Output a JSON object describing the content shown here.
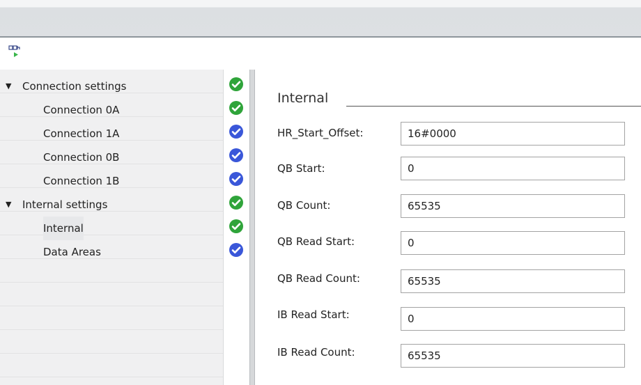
{
  "tree": [
    {
      "label": "Connection settings",
      "expanded": true,
      "level": 0,
      "status": "ok"
    },
    {
      "label": "Connection 0A",
      "level": 1,
      "status": "ok"
    },
    {
      "label": "Connection 1A",
      "level": 1,
      "status": "info"
    },
    {
      "label": "Connection 0B",
      "level": 1,
      "status": "info"
    },
    {
      "label": "Connection 1B",
      "level": 1,
      "status": "info"
    },
    {
      "label": "Internal settings",
      "expanded": true,
      "level": 0,
      "status": "ok"
    },
    {
      "label": "Internal",
      "level": 1,
      "status": "ok",
      "selected": true
    },
    {
      "label": "Data Areas",
      "level": 1,
      "status": "info"
    }
  ],
  "section": {
    "title": "Internal"
  },
  "fields": [
    {
      "label": "HR_Start_Offset:",
      "value": "16#0000"
    },
    {
      "label": "QB Start:",
      "value": "0"
    },
    {
      "label": "QB Count:",
      "value": "65535"
    },
    {
      "label": "QB Read Start:",
      "value": "0"
    },
    {
      "label": "QB Read Count:",
      "value": "65535"
    },
    {
      "label": "IB Read Start:",
      "value": "0"
    },
    {
      "label": "IB Read Count:",
      "value": "65535"
    }
  ],
  "colors": {
    "ok": "#2fa43a",
    "info": "#3a57d9"
  },
  "icons": {
    "toolbar": "compile-icon",
    "ok": "checkmark-icon",
    "info": "checkmark-icon"
  }
}
